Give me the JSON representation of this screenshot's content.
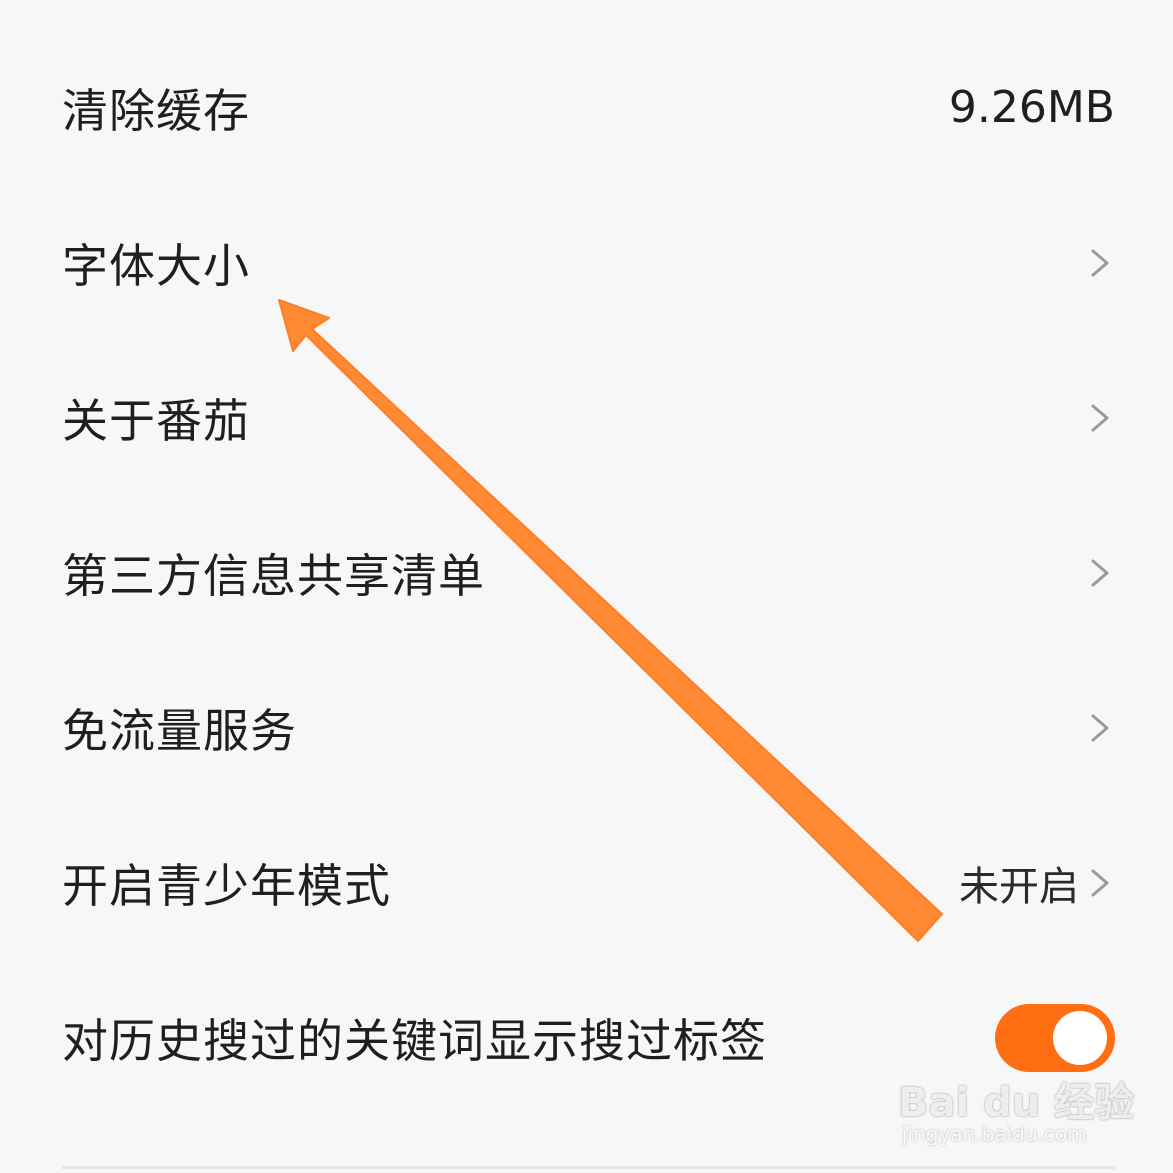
{
  "settings": {
    "clear_cache": {
      "label": "清除缓存",
      "value": "9.26MB"
    },
    "font_size": {
      "label": "字体大小"
    },
    "about": {
      "label": "关于番茄"
    },
    "third_party": {
      "label": "第三方信息共享清单"
    },
    "free_data": {
      "label": "免流量服务"
    },
    "teen_mode": {
      "label": "开启青少年模式",
      "value": "未开启"
    },
    "search_tags": {
      "label": "对历史搜过的关键词显示搜过标签",
      "toggle_on": true
    }
  },
  "colors": {
    "accent": "#ff6e12",
    "annotation_arrow": "#ff8a33",
    "chevron": "#9a9a9a"
  },
  "icons": {
    "chevron": "chevron-right-icon",
    "arrow": "annotation-arrow-icon"
  },
  "watermark": {
    "logo": "Bai du 经验",
    "url": "jingyan.baidu.com"
  }
}
